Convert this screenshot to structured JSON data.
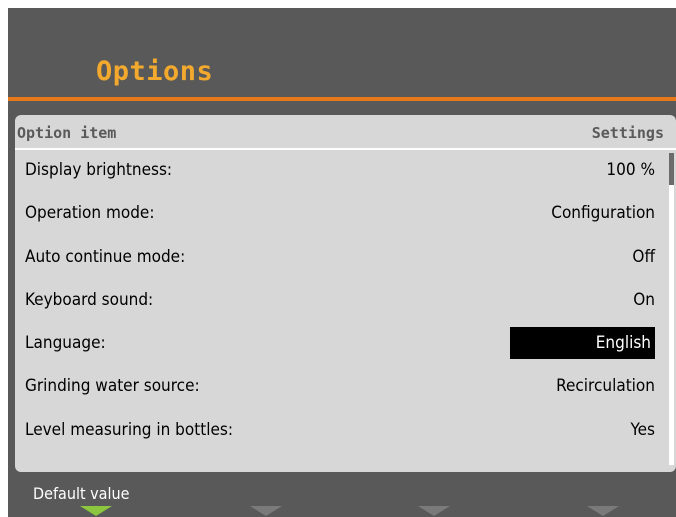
{
  "header": {
    "title": "Options"
  },
  "table": {
    "col_left": "Option item",
    "col_right": "Settings",
    "rows": [
      {
        "label": "Display brightness:",
        "value": "100 %"
      },
      {
        "label": "Operation mode:",
        "value": "Configuration"
      },
      {
        "label": "Auto continue mode:",
        "value": "Off"
      },
      {
        "label": "Keyboard sound:",
        "value": "On"
      },
      {
        "label": "Language:",
        "value": "English",
        "selected": true
      },
      {
        "label": "Grinding water source:",
        "value": "Recirculation"
      },
      {
        "label": "Level measuring in bottles:",
        "value": "Yes"
      }
    ]
  },
  "scrollbar": {
    "position_fraction": 0.0
  },
  "footer": {
    "label": "Default value",
    "softkeys": [
      {
        "name": "softkey-1",
        "active": true
      },
      {
        "name": "softkey-2",
        "active": false
      },
      {
        "name": "softkey-3",
        "active": false
      },
      {
        "name": "softkey-4",
        "active": false
      }
    ]
  },
  "colors": {
    "background": "#595959",
    "title": "#f2a92e",
    "accent_rule": "#e8791a",
    "panel": "#d7d7d7",
    "softkey_active": "#8cc63f",
    "softkey_inactive": "#7a7a7a"
  }
}
